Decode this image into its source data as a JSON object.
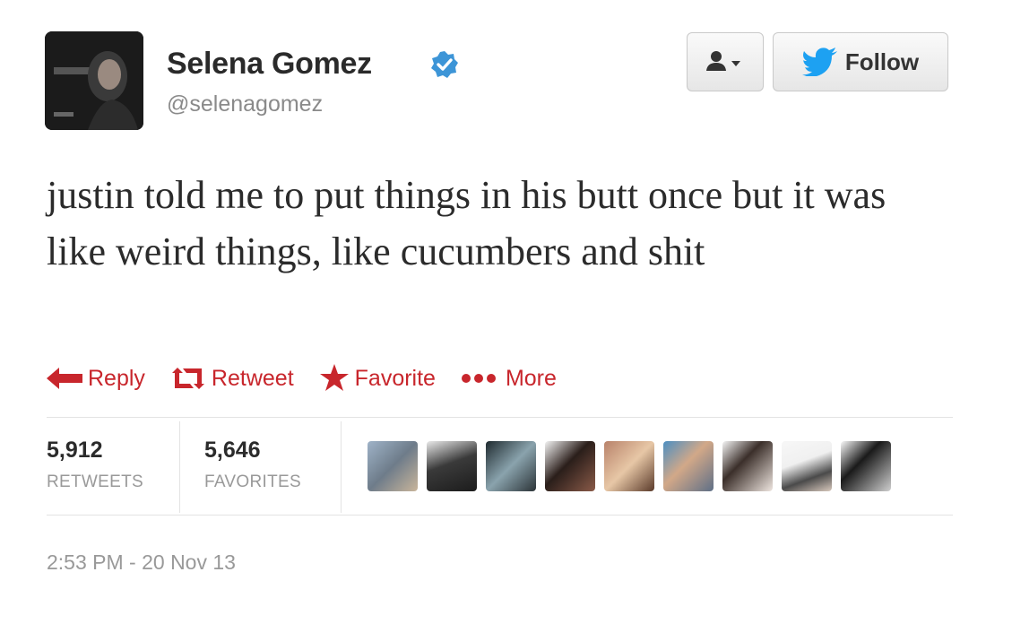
{
  "header": {
    "name": "Selena Gomez",
    "handle": "@selenagomez",
    "verified": true
  },
  "buttons": {
    "user_menu_icon": "user-dropdown-icon",
    "follow_label": "Follow"
  },
  "tweet": {
    "text": "justin told me to put things in his butt once but it was like weird things, like cucumbers and shit"
  },
  "actions": [
    {
      "label": "Reply",
      "icon": "reply-arrow-icon"
    },
    {
      "label": "Retweet",
      "icon": "retweet-icon"
    },
    {
      "label": "Favorite",
      "icon": "star-icon"
    },
    {
      "label": "More",
      "icon": "more-dots-icon"
    }
  ],
  "stats": {
    "retweets": {
      "value": "5,912",
      "label": "RETWEETS"
    },
    "favorites": {
      "value": "5,646",
      "label": "FAVORITES"
    }
  },
  "timestamp": "2:53 PM - 20 Nov 13",
  "colors": {
    "action_red": "#c8262c",
    "twitter_blue": "#1da1f2",
    "verified_blue": "#3d95d7"
  }
}
